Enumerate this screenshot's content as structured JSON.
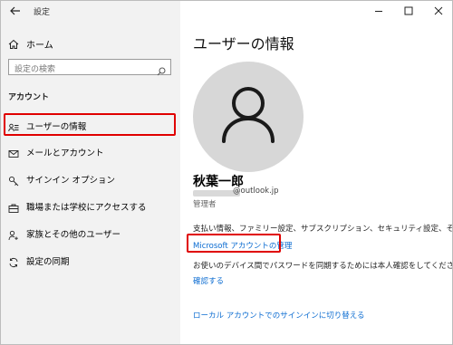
{
  "window": {
    "title": "設定"
  },
  "sidebar": {
    "home": "ホーム",
    "search": {
      "placeholder": "設定の検索"
    },
    "section_title": "アカウント",
    "items": [
      {
        "label": "ユーザーの情報",
        "icon": "user-info-icon",
        "selected": true
      },
      {
        "label": "メールとアカウント",
        "icon": "mail-icon"
      },
      {
        "label": "サインイン オプション",
        "icon": "key-icon"
      },
      {
        "label": "職場または学校にアクセスする",
        "icon": "briefcase-icon"
      },
      {
        "label": "家族とその他のユーザー",
        "icon": "person-add-icon"
      },
      {
        "label": "設定の同期",
        "icon": "sync-icon"
      }
    ]
  },
  "main": {
    "title": "ユーザーの情報",
    "user_name": "秋葉一郎",
    "email_domain": "@outlook.jp",
    "role": "管理者",
    "info_text": "支払い情報、ファミリー設定、サブスクリプション、セキュリティ設定、その他",
    "manage_link": "Microsoft アカウントの管理",
    "sync_text": "お使いのデバイス間でパスワードを同期するためには本人確認をしてください。",
    "verify_link": "確認する",
    "local_link": "ローカル アカウントでのサインインに切り替える"
  },
  "colors": {
    "accent": "#0a6bd1",
    "highlight": "#e00000",
    "sidebar_bg": "#f2f2f2"
  }
}
